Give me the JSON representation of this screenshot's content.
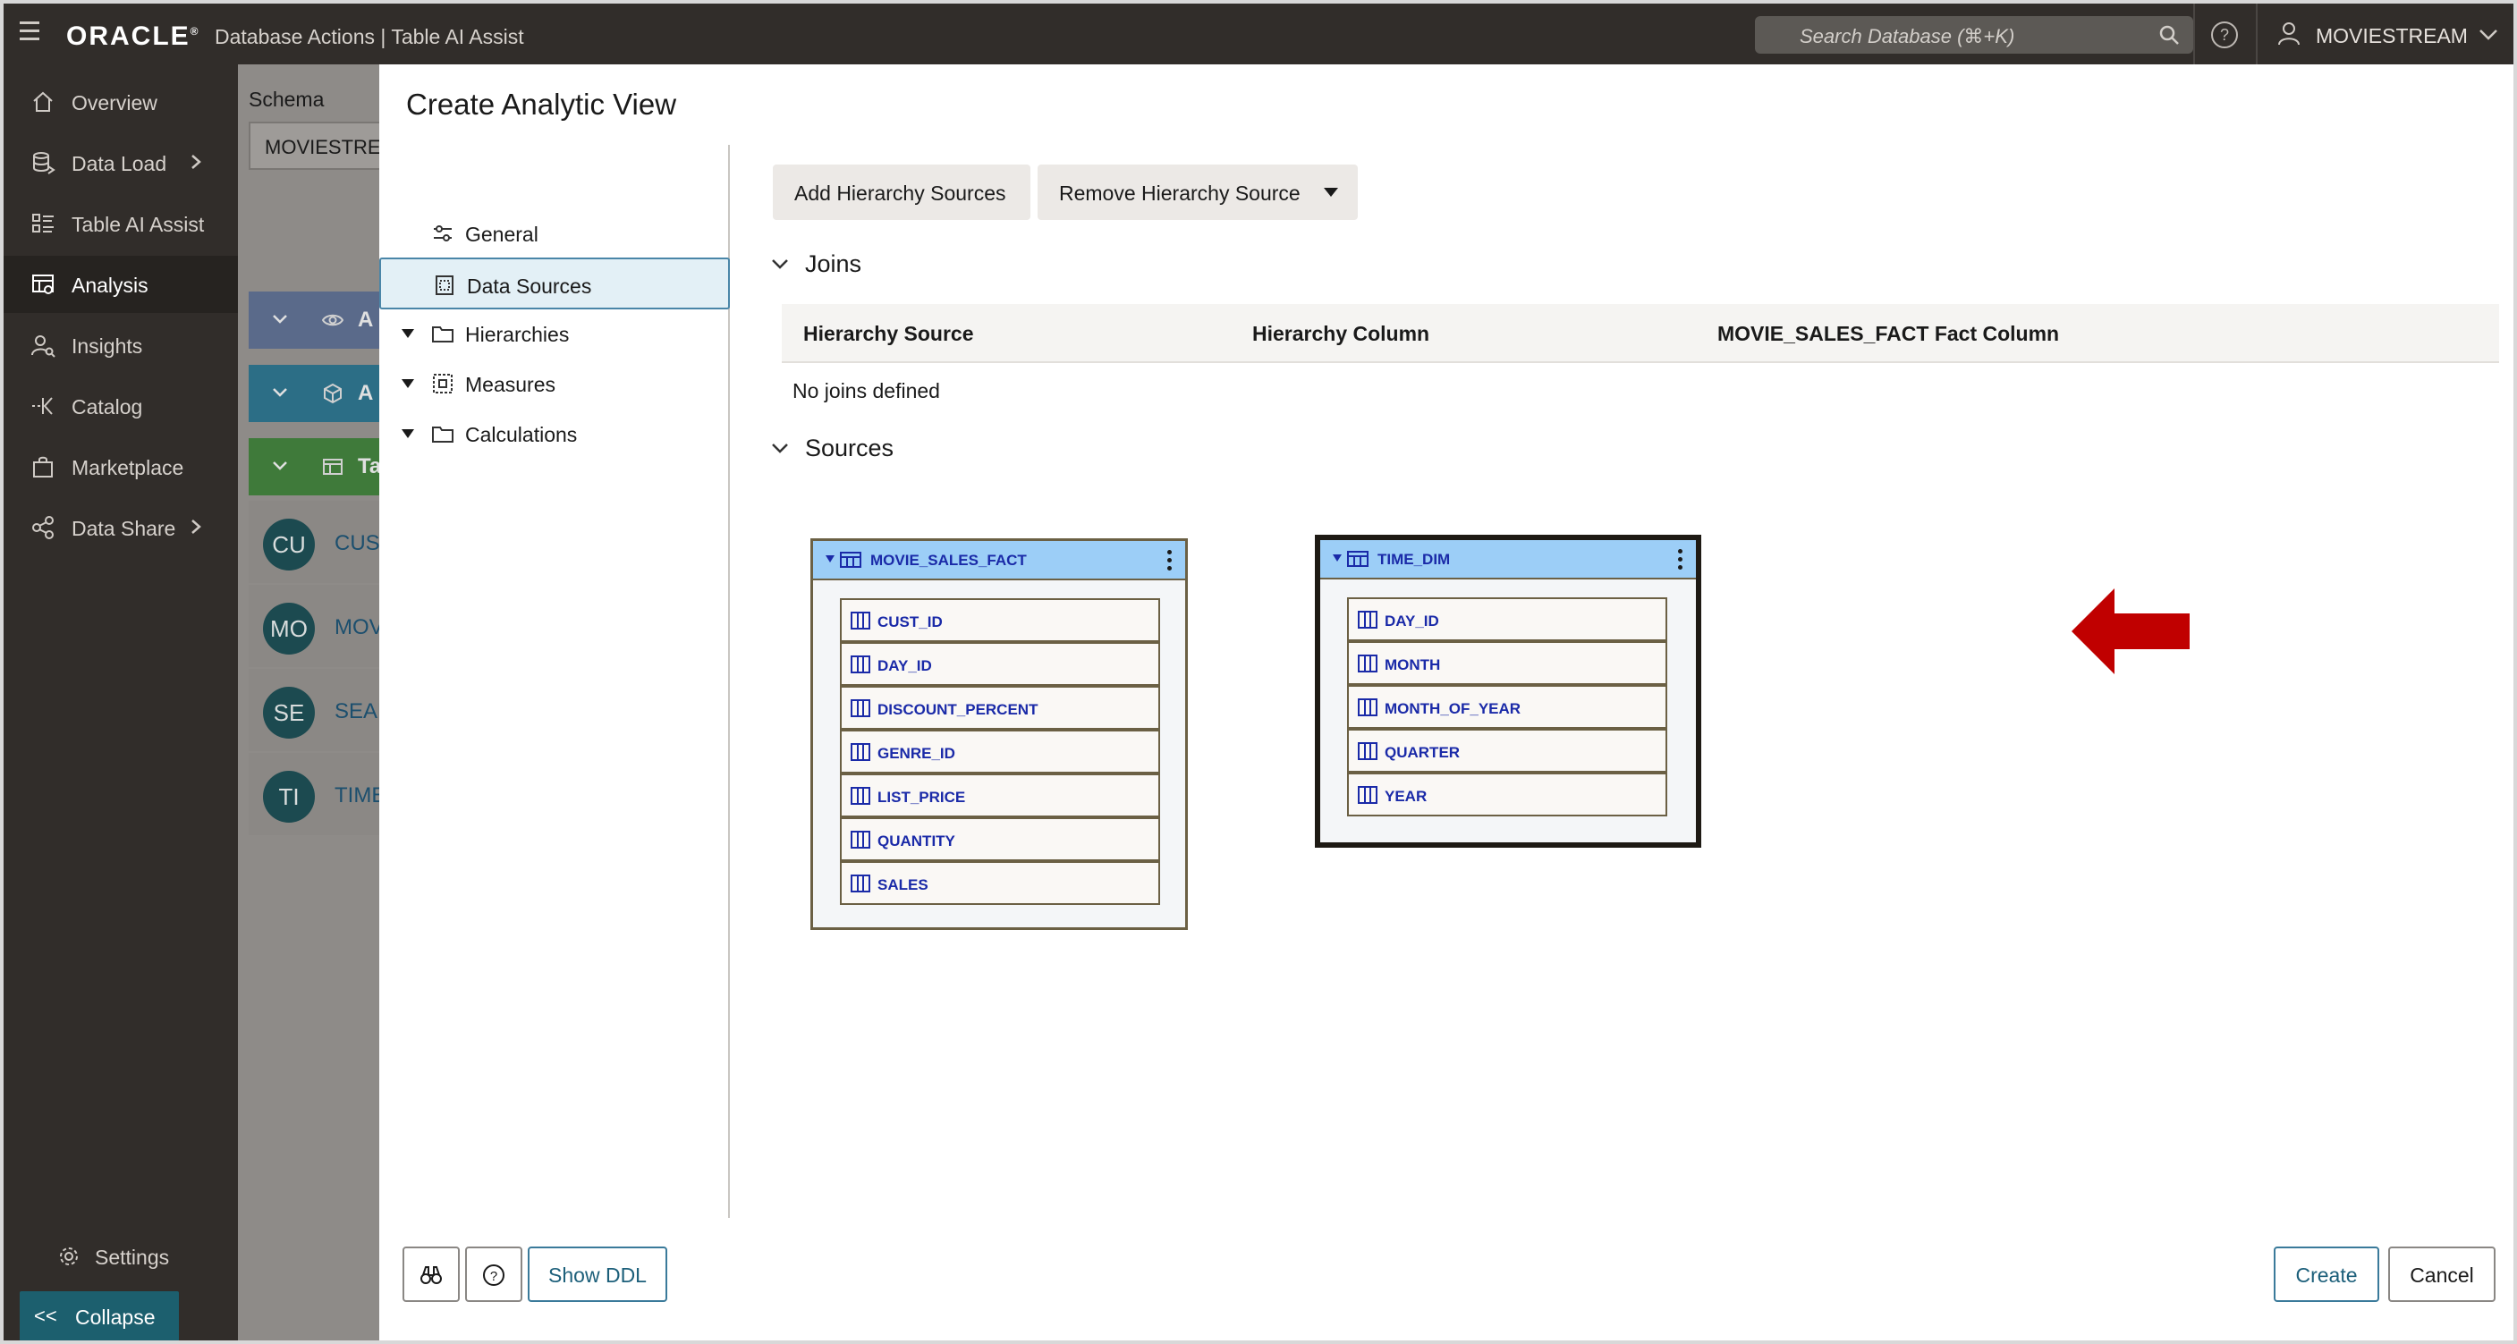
{
  "topbar": {
    "logo": "ORACLE",
    "logo_mark": "®",
    "app_title": "Database Actions | Table AI Assist",
    "search_placeholder": "Search Database (⌘+K)",
    "help_glyph": "?",
    "user": "MOVIESTREAM"
  },
  "leftnav": {
    "items": [
      {
        "label": "Overview",
        "icon": "home-icon"
      },
      {
        "label": "Data Load",
        "icon": "database-icon"
      },
      {
        "label": "Table AI Assist",
        "icon": "list-icon"
      },
      {
        "label": "Analysis",
        "icon": "analysis-icon"
      },
      {
        "label": "Insights",
        "icon": "insights-icon"
      },
      {
        "label": "Catalog",
        "icon": "catalog-icon"
      },
      {
        "label": "Marketplace",
        "icon": "bag-icon"
      },
      {
        "label": "Data Share",
        "icon": "share-icon"
      }
    ],
    "settings": "Settings",
    "collapse_glyph": "<<",
    "collapse": "Collapse"
  },
  "background_page": {
    "schema_label": "Schema",
    "schema_value": "MOVIESTREAM",
    "bands": [
      {
        "text": "A",
        "color": "#5a6a8a"
      },
      {
        "text": "A",
        "color": "#2c6e86"
      },
      {
        "text": "Ta",
        "color": "#3f7a3a"
      }
    ],
    "rows": [
      {
        "initials": "CU",
        "text": "CUSTOMER"
      },
      {
        "initials": "MO",
        "text": "MOVIE"
      },
      {
        "initials": "SE",
        "text": "SEARCH"
      },
      {
        "initials": "TI",
        "text": "TIME_DIM"
      }
    ]
  },
  "dialog": {
    "title": "Create Analytic View",
    "nav": [
      {
        "label": "General",
        "icon": "sliders-icon",
        "expandable": false
      },
      {
        "label": "Data Sources",
        "icon": "datasource-icon",
        "expandable": false,
        "selected": true
      },
      {
        "label": "Hierarchies",
        "icon": "folder-icon",
        "expandable": true
      },
      {
        "label": "Measures",
        "icon": "measure-icon",
        "expandable": true
      },
      {
        "label": "Calculations",
        "icon": "folder-icon",
        "expandable": true
      }
    ],
    "buttons": {
      "add_hierarchy_sources": "Add Hierarchy Sources",
      "remove_hierarchy_source": "Remove Hierarchy Source"
    },
    "joins": {
      "title": "Joins",
      "columns": [
        "Hierarchy Source",
        "Hierarchy Column",
        "MOVIE_SALES_FACT Fact Column"
      ],
      "empty": "No joins defined"
    },
    "sources": {
      "title": "Sources",
      "tables": [
        {
          "name": "MOVIE_SALES_FACT",
          "highlighted": false,
          "columns": [
            "CUST_ID",
            "DAY_ID",
            "DISCOUNT_PERCENT",
            "GENRE_ID",
            "LIST_PRICE",
            "QUANTITY",
            "SALES"
          ]
        },
        {
          "name": "TIME_DIM",
          "highlighted": true,
          "columns": [
            "DAY_ID",
            "MONTH",
            "MONTH_OF_YEAR",
            "QUARTER",
            "YEAR"
          ]
        }
      ]
    },
    "footer": {
      "show_ddl": "Show DDL",
      "help_glyph": "?",
      "create": "Create",
      "cancel": "Cancel"
    }
  },
  "colors": {
    "topbar": "#312d2a",
    "accent_teal": "#1c5f6e",
    "table_header": "#9ccef7",
    "column_text": "#1a2aa8",
    "annotation_arrow": "#c00000"
  }
}
